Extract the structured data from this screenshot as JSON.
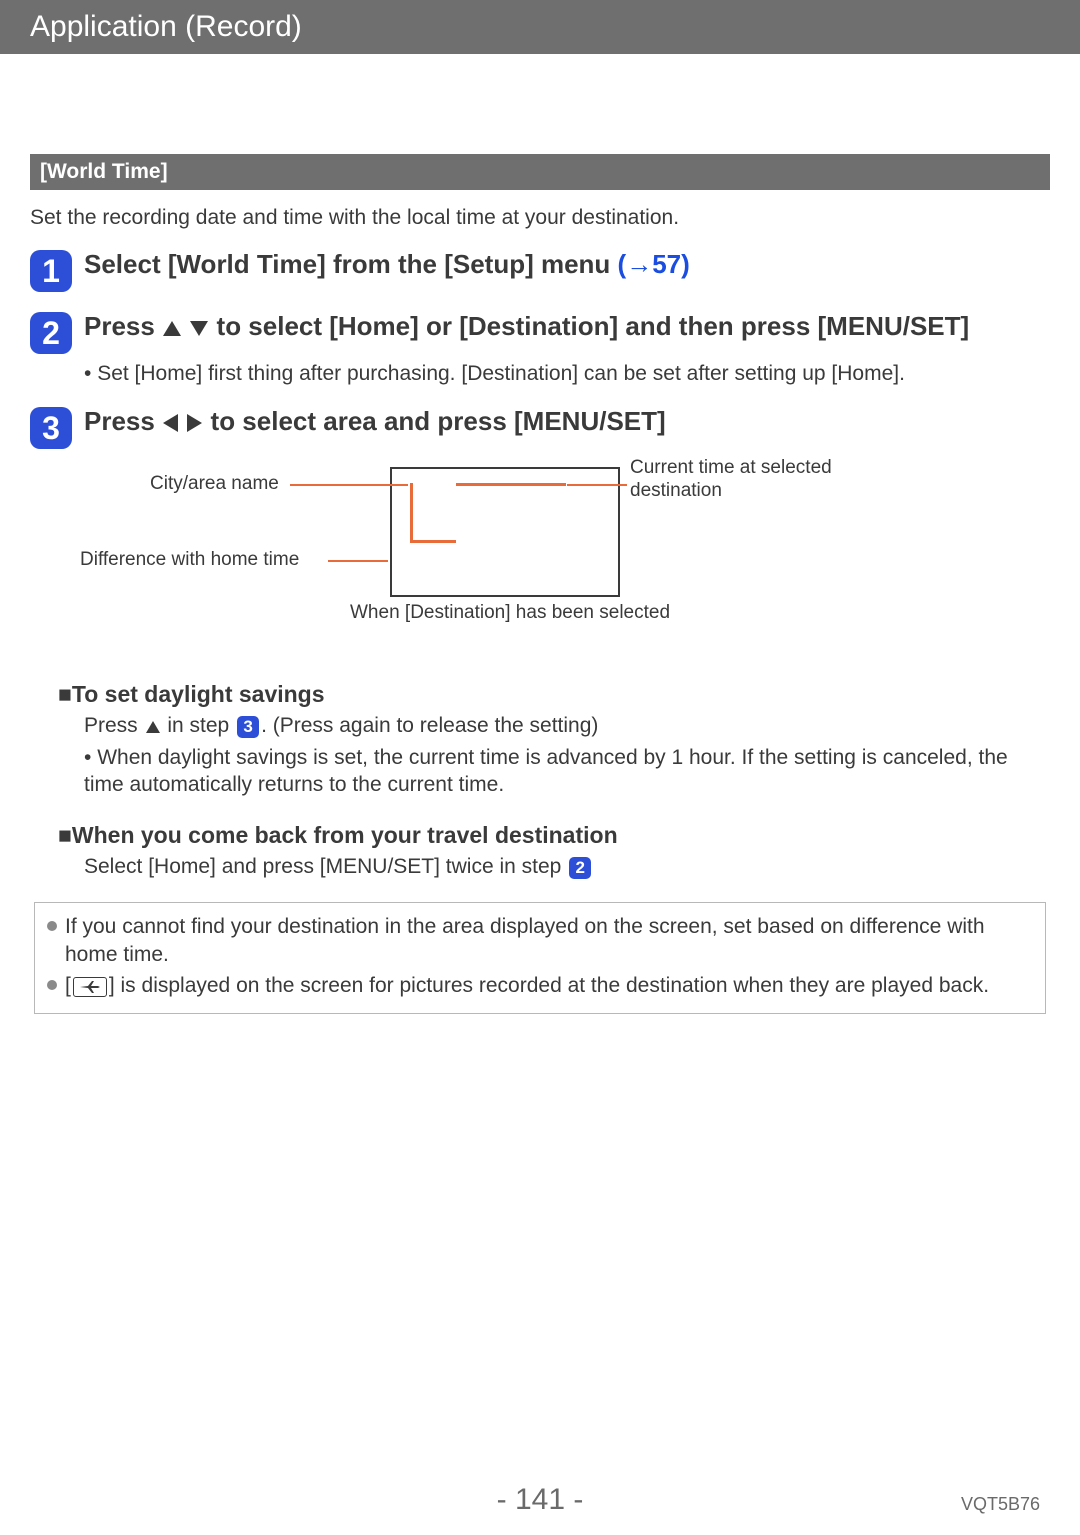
{
  "header": {
    "title": "Application (Record)"
  },
  "section": {
    "subtitle": "[World Time]",
    "intro": "Set the recording date and time with the local time at your destination."
  },
  "steps": {
    "s1": {
      "num": "1",
      "title_a": "Select [World Time] from the [Setup] menu ",
      "link": "(→57)"
    },
    "s2": {
      "num": "2",
      "title_a": "Press ",
      "title_b": " to select [Home] or [Destination] and then press [MENU/SET]",
      "body": "Set [Home] first thing after purchasing. [Destination] can be set after setting up [Home]."
    },
    "s3": {
      "num": "3",
      "title_a": "Press ",
      "title_b": " to select area and press [MENU/SET]"
    }
  },
  "diagram": {
    "label_city": "City/area name",
    "label_diff": "Difference with home time",
    "label_time": "Current time at selected destination",
    "caption": "When [Destination] has been selected"
  },
  "daylight": {
    "heading": "■To set daylight savings",
    "line1_a": "Press ",
    "line1_b": " in step ",
    "badge": "3",
    "line1_c": ". (Press again to release the setting)",
    "bullet": "When daylight savings is set, the current time is advanced by 1 hour. If the setting is canceled, the time automatically returns to the current time."
  },
  "comeback": {
    "heading": "■When you come back from your travel destination",
    "line_a": "Select [Home] and press [MENU/SET] twice in step ",
    "badge": "2"
  },
  "notes": {
    "n1": "If you cannot find your destination in the area displayed on the screen, set based on difference with home time.",
    "n2_a": "[",
    "n2_b": "] is displayed on the screen for pictures recorded at the destination when they are played back."
  },
  "footer": {
    "page": "- 141 -",
    "code": "VQT5B76"
  }
}
